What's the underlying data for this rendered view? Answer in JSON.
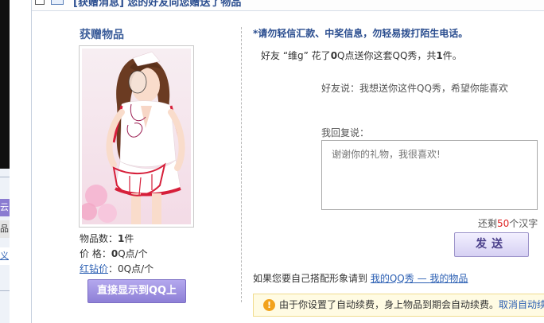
{
  "sidebar": {
    "items": [
      {
        "label": "云",
        "style": "purple"
      },
      {
        "label": "品",
        "style": "gray"
      },
      {
        "label": "义",
        "style": "link"
      }
    ]
  },
  "header": {
    "title": "[获赠消息] 您的好友向您赠送了物品"
  },
  "gift": {
    "heading": "获赠物品",
    "count_label": "物品数：",
    "count_value": "1",
    "count_unit": "件",
    "price_label": "价  格：",
    "price_value": "0",
    "price_unit": "Q点/个",
    "diamond_label": "红钻价",
    "diamond_sep": "：",
    "diamond_value": "0Q点/个",
    "show_button": "直接显示到QQ上"
  },
  "message": {
    "warning": "*请勿轻信汇款、中奖信息，勿轻易拨打陌生电话。",
    "sent_prefix": "好友 “维g” 花了",
    "sent_amount": "0",
    "sent_middle": "Q点送你这套QQ秀，共",
    "sent_count": "1",
    "sent_suffix": "件。",
    "friend_says": "好友说：我想送你这件QQ秀，希望你能喜欢",
    "my_reply_label": "我回复说：",
    "reply_placeholder": "谢谢你的礼物，我很喜欢!",
    "remain_prefix": "还剩",
    "remain_count": "50",
    "remain_suffix": "个汉字",
    "send_button": "发送",
    "match_text": "如果您要自己搭配形象请到",
    "link_my_qqshow": "我的QQ秀",
    "link_sep": " — ",
    "link_my_items": "我的物品"
  },
  "notice": {
    "icon": "warning-icon",
    "text": "由于你设置了自动续费，身上物品到期会自动续费。",
    "link": "取消自动续费"
  },
  "colors": {
    "accent": "#2a4d8f",
    "button_purple": "#8d7fd6",
    "count_red": "#dd2222",
    "notice_bg": "#fffbe3"
  }
}
